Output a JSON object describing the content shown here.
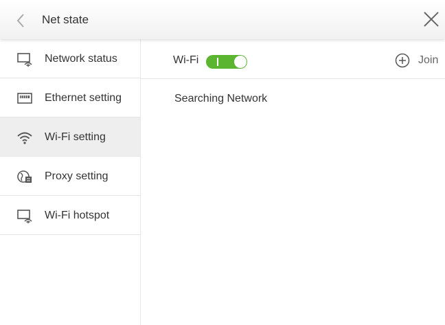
{
  "header": {
    "title": "Net state",
    "back_icon": "chevron-left-icon",
    "close_icon": "close-icon"
  },
  "sidebar": {
    "items": [
      {
        "label": "Network status",
        "icon": "network-status-icon",
        "active": false
      },
      {
        "label": "Ethernet setting",
        "icon": "ethernet-icon",
        "active": false
      },
      {
        "label": "Wi-Fi setting",
        "icon": "wifi-icon",
        "active": true
      },
      {
        "label": "Proxy setting",
        "icon": "proxy-globe-icon",
        "active": false
      },
      {
        "label": "Wi-Fi hotspot",
        "icon": "hotspot-icon",
        "active": false
      }
    ]
  },
  "main": {
    "wifi_label": "Wi-Fi",
    "wifi_toggle": {
      "state": "on",
      "on_mark": "I",
      "color": "#5cb531"
    },
    "join_label": "Join",
    "status_text": "Searching Network"
  }
}
